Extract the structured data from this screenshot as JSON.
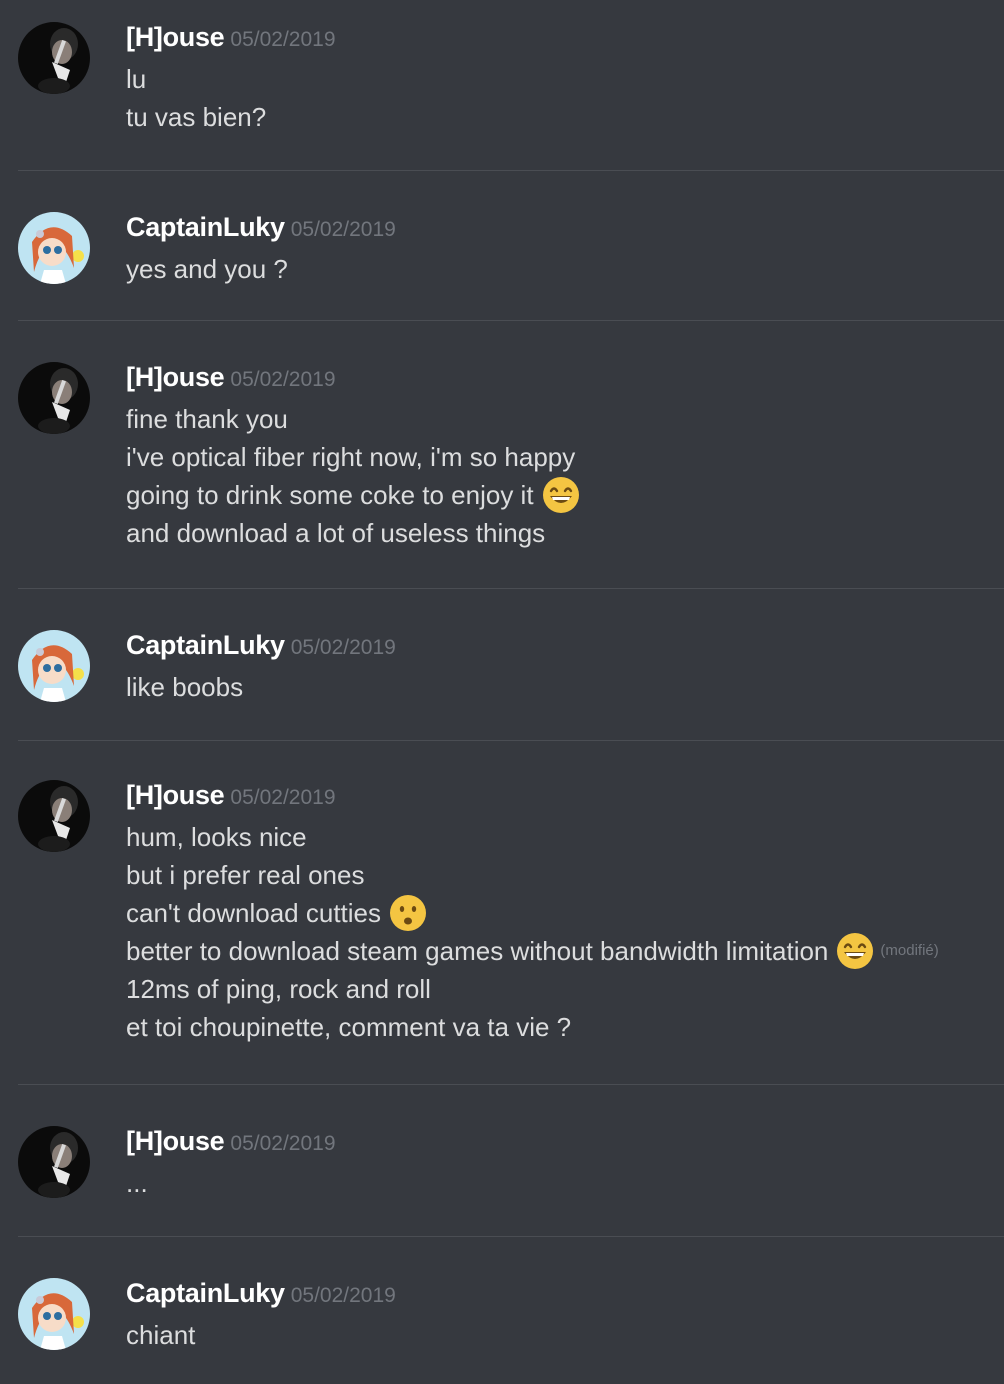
{
  "messages": [
    {
      "author": "[H]ouse",
      "timestamp": "05/02/2019",
      "avatar": "house-avatar",
      "lines": [
        {
          "text": "lu"
        },
        {
          "text": "tu vas bien?"
        }
      ]
    },
    {
      "author": "CaptainLuky",
      "timestamp": "05/02/2019",
      "avatar": "captainluky-avatar",
      "lines": [
        {
          "text": "yes and you ?"
        }
      ]
    },
    {
      "author": "[H]ouse",
      "timestamp": "05/02/2019",
      "avatar": "house-avatar",
      "lines": [
        {
          "text": "fine thank you"
        },
        {
          "text": "i've optical fiber right now, i'm so happy"
        },
        {
          "text": "going to drink some coke to enjoy it",
          "emoji": "grinning-smiling-eyes"
        },
        {
          "text": "and download a lot of useless things"
        }
      ]
    },
    {
      "author": "CaptainLuky",
      "timestamp": "05/02/2019",
      "avatar": "captainluky-avatar",
      "lines": [
        {
          "text": "like boobs"
        }
      ]
    },
    {
      "author": "[H]ouse",
      "timestamp": "05/02/2019",
      "avatar": "house-avatar",
      "lines": [
        {
          "text": "hum, looks nice"
        },
        {
          "text": "but i prefer real ones"
        },
        {
          "text": "can't download cutties",
          "emoji": "frowning-open-mouth"
        },
        {
          "text": "better to download steam games without bandwidth limitation",
          "emoji": "grinning-smiling-eyes",
          "edited": "(modifié)"
        },
        {
          "text": "12ms of ping, rock and roll"
        },
        {
          "text": "et toi choupinette, comment va ta vie ?"
        }
      ]
    },
    {
      "author": "[H]ouse",
      "timestamp": "05/02/2019",
      "avatar": "house-avatar",
      "lines": [
        {
          "text": "..."
        }
      ]
    },
    {
      "author": "CaptainLuky",
      "timestamp": "05/02/2019",
      "avatar": "captainluky-avatar",
      "lines": [
        {
          "text": "chiant"
        }
      ]
    }
  ],
  "colors": {
    "background": "#36393f",
    "divider": "#4a4d53",
    "username": "#ffffff",
    "timestamp": "#72767d",
    "text": "#dcddde",
    "emoji": "#f4c542"
  }
}
